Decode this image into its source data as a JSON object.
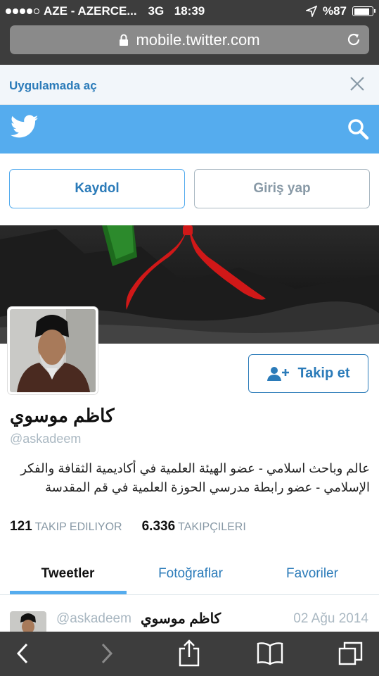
{
  "status": {
    "carrier": "AZE - AZERCE...",
    "network": "3G",
    "time": "18:39",
    "battery_text": "%87",
    "battery_level": 0.87
  },
  "browser": {
    "url": "mobile.twitter.com"
  },
  "banner": {
    "open_app": "Uygulamada aç"
  },
  "actions": {
    "signup": "Kaydol",
    "login": "Giriş yap",
    "follow": "Takip et"
  },
  "profile": {
    "name": "كاظم موسوي",
    "handle": "@askadeem",
    "bio": "عالم وباحث اسلامي - عضو الهيئة العلمية في أكاديمية الثقافة والفكر الإسلامي - عضو رابطة مدرسي الحوزة العلمية في قم المقدسة",
    "following_count": "121",
    "following_label": "TAKIP EDILIYOR",
    "followers_count": "6.336",
    "followers_label": "TAKIPÇILERI"
  },
  "tabs": [
    "Tweetler",
    "Fotoğraflar",
    "Favoriler"
  ],
  "tweet": {
    "handle": "@askadeem",
    "name": "كاظم موسوي",
    "date": "02 Ağu 2014"
  },
  "colors": {
    "twitter_blue": "#55acee",
    "link_blue": "#2b7bb9",
    "chrome_dark": "#3d3d3d"
  },
  "icons": [
    "twitter-bird-icon",
    "search-icon",
    "close-icon",
    "lock-icon",
    "reload-icon",
    "add-user-icon",
    "back-icon",
    "forward-icon",
    "share-icon",
    "bookmarks-icon",
    "tabs-icon"
  ]
}
